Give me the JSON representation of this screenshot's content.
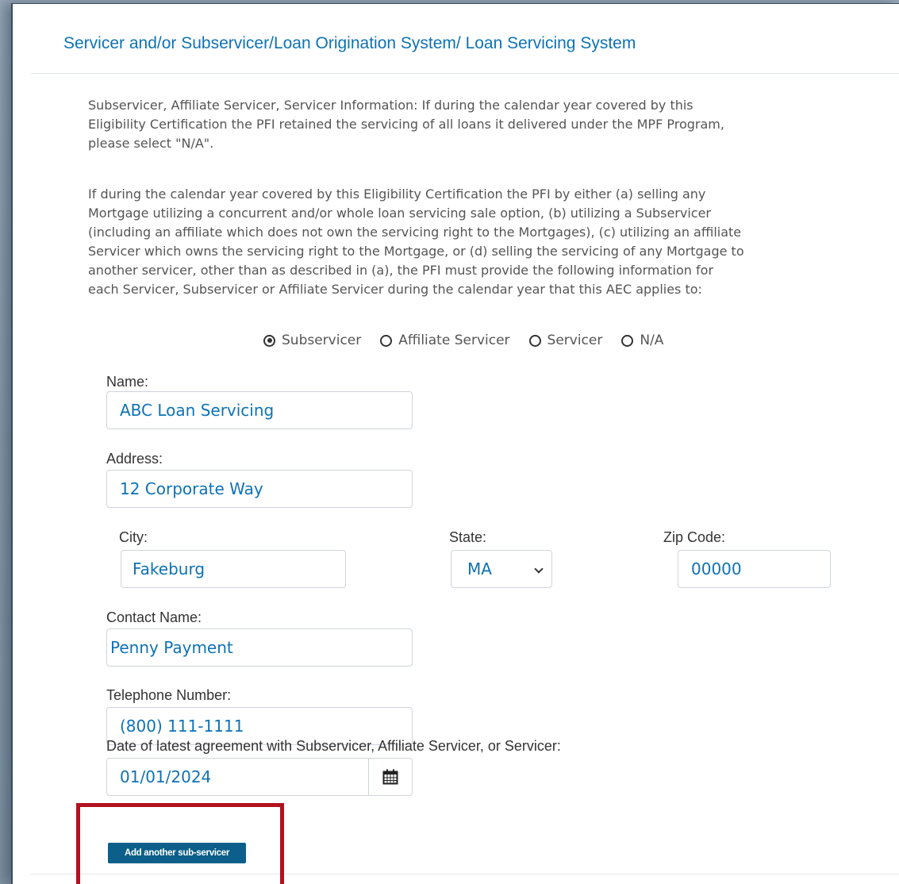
{
  "section": {
    "title": "Servicer and/or Subservicer/Loan Origination System/ Loan Servicing System",
    "intro_lines": [
      "Subservicer, Affiliate Servicer, Servicer Information: If during the calendar year covered by this",
      "Eligibility Certification the PFI retained the servicing of all loans it delivered under the MPF Program,",
      "please select \"N/A\"."
    ],
    "body_lines": [
      "If during the calendar year covered by this Eligibility Certification the PFI by either (a) selling any",
      "Mortgage utilizing a concurrent and/or whole loan servicing sale option, (b) utilizing a Subservicer",
      "(including an affiliate which does not own the servicing right to the Mortgages), (c) utilizing an affiliate",
      "Servicer which owns the servicing right to the Mortgage, or (d) selling the servicing of any Mortgage to",
      "another servicer, other than as described in (a), the PFI must provide the following information for",
      "each Servicer, Subservicer or Affiliate Servicer during the calendar year that this AEC applies to:"
    ]
  },
  "servicer_type": {
    "options": [
      "Subservicer",
      "Affiliate Servicer",
      "Servicer",
      "N/A"
    ],
    "selected": "Subservicer"
  },
  "form": {
    "name": {
      "label": "Name:",
      "value": "ABC Loan Servicing"
    },
    "address": {
      "label": "Address:",
      "value": "12 Corporate Way"
    },
    "city": {
      "label": "City:",
      "value": "Fakeburg"
    },
    "state": {
      "label": "State:",
      "value": "MA"
    },
    "zip": {
      "label": "Zip Code:",
      "value": "00000"
    },
    "contact": {
      "label": "Contact Name:",
      "value": "Penny Payment"
    },
    "phone": {
      "label": "Telephone Number:",
      "value": "(800) 111-1111"
    },
    "date": {
      "label": "Date of latest agreement with Subservicer, Affiliate Servicer, or Servicer:",
      "value": "01/01/2024"
    }
  },
  "actions": {
    "add_subservicer_label": "Add another sub-servicer"
  },
  "icons": {
    "calendar": "calendar-icon",
    "state_dropdown": "chevron-down-icon"
  },
  "colors": {
    "accent": "#0e72b5",
    "button": "#0b5f8a",
    "highlight": "#b0121e"
  }
}
